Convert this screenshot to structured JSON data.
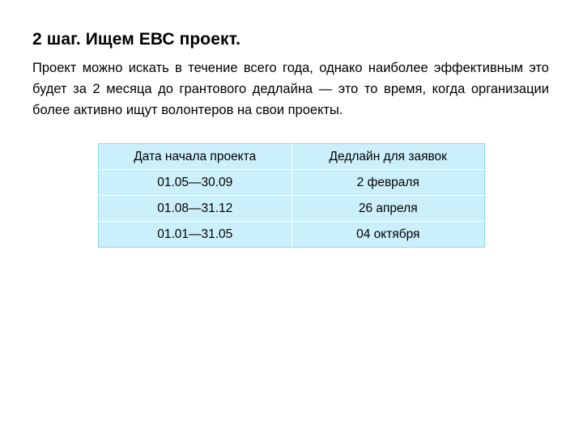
{
  "slide": {
    "title": "2 шаг. Ищем EВС проект.",
    "paragraph": "Проект можно искать в течение всего года, однако наиболее эффективным это будет за 2 месяца до грантового дедлайна — это то время, когда организации более активно ищут волонтеров на свои проекты.",
    "table": {
      "headers": [
        "Дата начала проекта",
        "Дедлайн для заявок"
      ],
      "rows": [
        [
          "01.05—30.09",
          "2 февраля"
        ],
        [
          "01.08—31.12",
          "26 апреля"
        ],
        [
          "01.01—31.05",
          "04 октября"
        ]
      ]
    },
    "colors": {
      "table_fill": "#ccf0fb",
      "table_border": "#8fd6ea",
      "background": "#ffffff",
      "text": "#000000"
    }
  }
}
